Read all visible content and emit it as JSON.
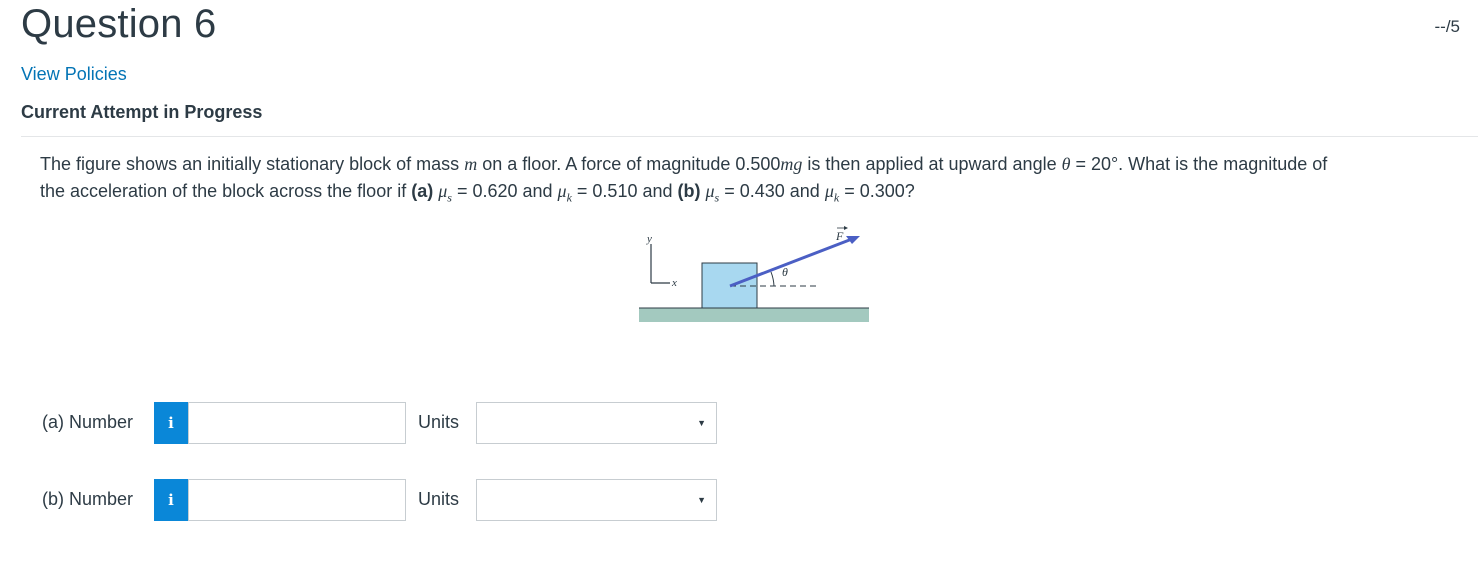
{
  "header": {
    "title": "Question 6",
    "score": "--/5",
    "policies_link": "View Policies",
    "attempt_status": "Current Attempt in Progress"
  },
  "question": {
    "line1_parts": {
      "p1": "The figure shows an initially stationary block of mass ",
      "m": "m",
      "p2": " on a floor. A force of magnitude 0.500",
      "mg": "mg",
      "p3": " is then applied at upward angle ",
      "theta": "θ",
      "p4": " = 20°. What is the magnitude of"
    },
    "line2_parts": {
      "p1": "the acceleration of the block across the floor if ",
      "a": "(a)",
      "mu_s_a": "μ",
      "s1": "s",
      "p2": " = 0.620 and ",
      "mu_k_a": "μ",
      "k1": "k",
      "p3": " = 0.510 and ",
      "b": "(b)",
      "mu_s_b": "μ",
      "s2": "s",
      "p4": " = 0.430 and ",
      "mu_k_b": "μ",
      "k2": "k",
      "p5": " = 0.300?"
    }
  },
  "figure": {
    "axis_y": "y",
    "axis_x": "x",
    "force_label": "F",
    "angle_label": "θ",
    "colors": {
      "block": "#a8d8f0",
      "floor": "#a3c9bf",
      "arrow": "#4b5fc4"
    }
  },
  "answers": [
    {
      "label": "(a) Number",
      "info_icon": "i",
      "value": "",
      "units_label": "Units",
      "units_value": ""
    },
    {
      "label": "(b) Number",
      "info_icon": "i",
      "value": "",
      "units_label": "Units",
      "units_value": ""
    }
  ],
  "colors": {
    "link": "#0374b5",
    "info_button": "#0a87d8",
    "text": "#2d3b45"
  }
}
